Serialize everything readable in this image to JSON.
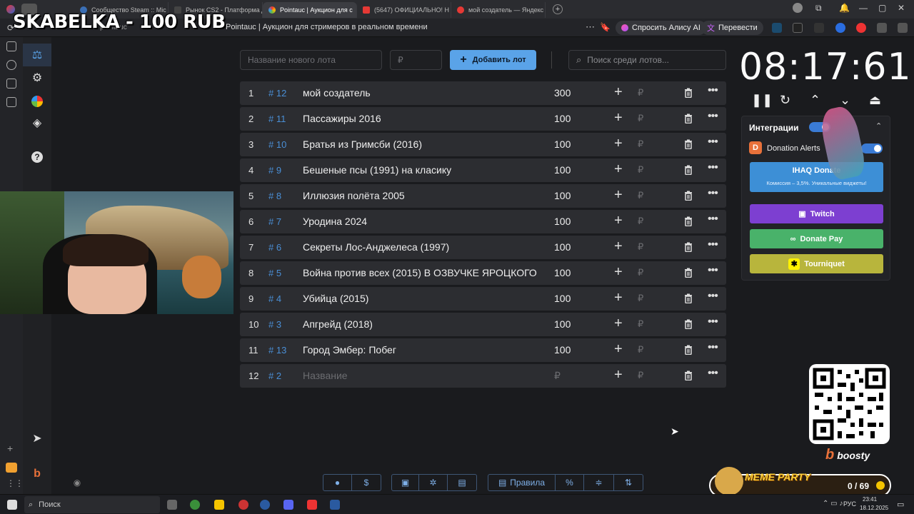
{
  "overlay_title": "SKABELKA - 100 RUB",
  "browser": {
    "tabs": [
      {
        "label": "",
        "color": "#6c6c6c"
      },
      {
        "label": "Сообщество Steam :: Mic",
        "color": "#3b6fb5"
      },
      {
        "label": "Рынок CS2 - Платформа д",
        "color": "#444"
      },
      {
        "label": "Pointauc | Аукцион для с",
        "color": "#6ab04c"
      },
      {
        "label": "(5647) ОФИЦИАЛЬНО! Н",
        "color": "#e53935"
      },
      {
        "label": "мой создатель — Яндекс",
        "color": "#e53935"
      }
    ],
    "page_title": "Pointauc | Аукцион для стримеров в реальном времени",
    "alice_label": "Спросить Алису AI",
    "translate_label": "Перевести",
    "short_url": "pointauc"
  },
  "toolbar": {
    "new_lot_placeholder": "Название нового лота",
    "amount_placeholder": "₽",
    "add_lot_label": "Добавить лот",
    "search_placeholder": "Поиск среди лотов..."
  },
  "lots": [
    {
      "num": "1",
      "id": "# 12",
      "name": "мой создатель",
      "amount": "300"
    },
    {
      "num": "2",
      "id": "# 11",
      "name": "Пассажиры 2016",
      "amount": "100"
    },
    {
      "num": "3",
      "id": "# 10",
      "name": "Братья из Гримсби (2016)",
      "amount": "100"
    },
    {
      "num": "4",
      "id": "# 9",
      "name": "Бешеные псы (1991) на класику",
      "amount": "100"
    },
    {
      "num": "5",
      "id": "# 8",
      "name": "Иллюзия полёта 2005",
      "amount": "100"
    },
    {
      "num": "6",
      "id": "# 7",
      "name": "Уродина 2024",
      "amount": "100"
    },
    {
      "num": "7",
      "id": "# 6",
      "name": "Секреты Лос-Анджелеса (1997)",
      "amount": "100"
    },
    {
      "num": "8",
      "id": "# 5",
      "name": "Война против всех (2015) В ОЗВУЧКЕ ЯРОЦКОГО",
      "amount": "100"
    },
    {
      "num": "9",
      "id": "# 4",
      "name": "Убийца (2015)",
      "amount": "100"
    },
    {
      "num": "10",
      "id": "# 3",
      "name": "Апгрейд (2018)",
      "amount": "100"
    },
    {
      "num": "11",
      "id": "# 13",
      "name": "Город Эмбер: Побег",
      "amount": "100"
    },
    {
      "num": "12",
      "id": "# 2",
      "name": "Название",
      "amount": "₽",
      "placeholder": true
    }
  ],
  "rub_symbol": "₽",
  "timer": "08:17:61",
  "integrations": {
    "title": "Интеграции",
    "donation_alerts": "Donation Alerts",
    "ihaq_title": "IHAQ Donate",
    "ihaq_sub": "Комиссия – 3,5%. Уникальные виджеты!",
    "twitch": "Twitch",
    "donatepay": "Donate Pay",
    "tourniquet": "Tourniquet"
  },
  "bottom": {
    "rules_label": "Правила",
    "percent_label": "%",
    "dollar_label": "$"
  },
  "overlay": {
    "boosty": "boosty",
    "meme_party": "MEME PARTY",
    "meme_count": "0 / 69"
  },
  "taskbar": {
    "search_label": "Поиск",
    "lang": "РУС",
    "time": "23:41",
    "date": "18.12.2025"
  },
  "colors": {
    "accent": "#5aa3e8",
    "twitch": "#7d3fd1",
    "donatepay": "#49b26a",
    "tourniquet": "#b8b53c",
    "ihaq": "#3d8fd6"
  }
}
